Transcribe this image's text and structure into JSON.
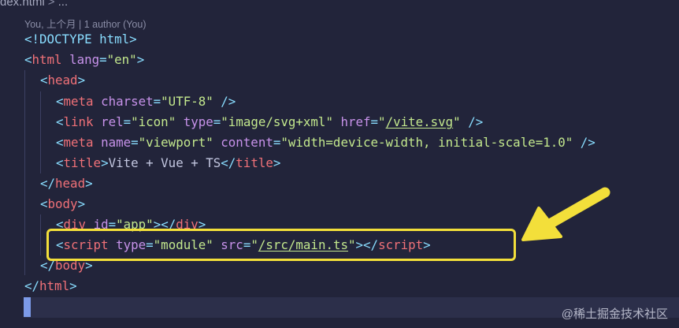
{
  "breadcrumb": {
    "file": "dex.html",
    "sep": ">",
    "more": "..."
  },
  "codelens": {
    "text": "You, 上个月 | 1 author (You)"
  },
  "code": {
    "doctype": "<!DOCTYPE html>",
    "html_lang_value": "\"en\"",
    "charset_value": "\"UTF-8\"",
    "icon_rel_value": "\"icon\"",
    "icon_type_value": "\"image/svg+xml\"",
    "icon_href_value": "/vite.svg",
    "viewport_name_value": "\"viewport\"",
    "viewport_content_value": "\"width=device-width, initial-scale=1.0\"",
    "title_text": "Vite + Vue + TS",
    "div_id_value": "\"app\"",
    "script_type_value": "\"module\"",
    "script_src_value": "/src/main.ts"
  },
  "annotation": {
    "box_color": "#f3df3a",
    "arrow_color": "#f3df3a"
  },
  "watermark": {
    "text": "@稀土掘金技术社区"
  }
}
